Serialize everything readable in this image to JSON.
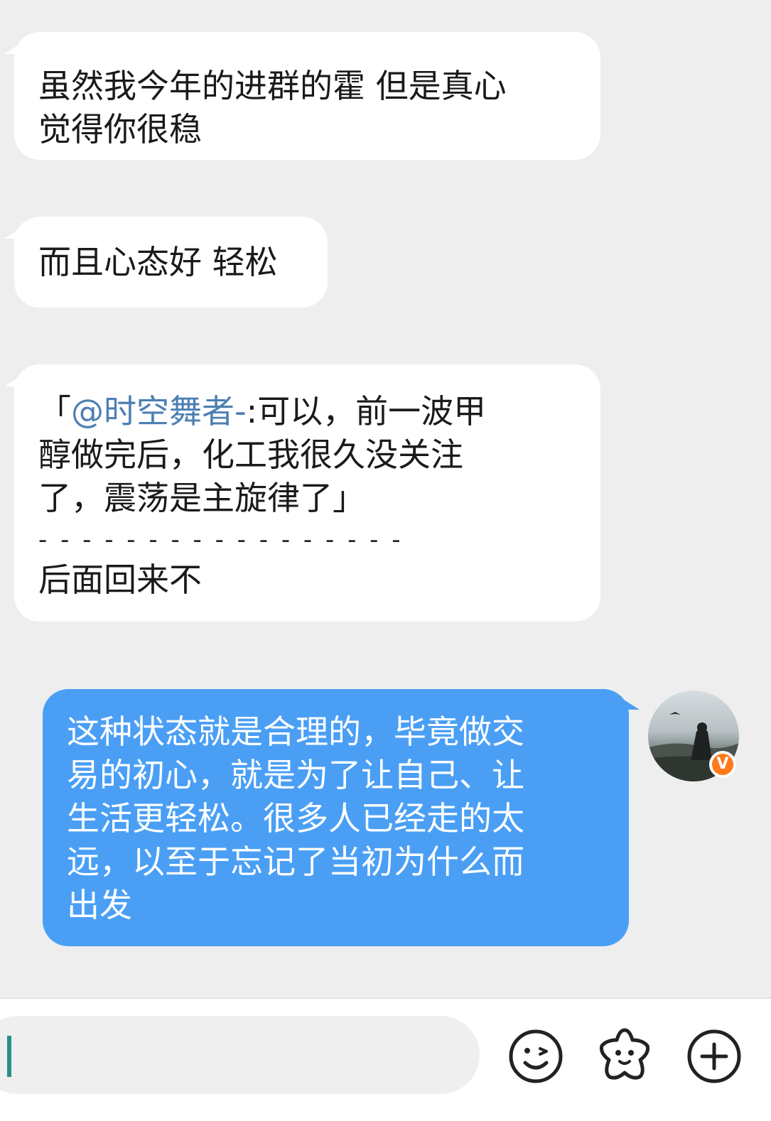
{
  "messages": [
    {
      "side": "incoming",
      "lines": [
        "虽然我今年的进群的霍 但是真心",
        "觉得你很稳"
      ]
    },
    {
      "side": "incoming",
      "text": "而且心态好 轻松"
    },
    {
      "side": "incoming",
      "quote": {
        "open": "「",
        "mention": "@时空舞者-",
        "rest_line1": ":可以，前一波甲",
        "line2": "醇做完后，化工我很久没关注",
        "line3": "了，震荡是主旋律了」"
      },
      "divider": "- - - - - - - - - - - - - - - - -",
      "reply": "后面回来不"
    },
    {
      "side": "outgoing",
      "lines": [
        "这种状态就是合理的，毕竟做交",
        "易的初心，就是为了让自己、让",
        "生活更轻松。很多人已经走的太",
        "远，以至于忘记了当初为什么而",
        "出发"
      ]
    }
  ],
  "avatar": {
    "badge": "V"
  },
  "composer": {
    "placeholder": ""
  },
  "toolbar": {
    "icons": [
      "emoji-icon",
      "sticker-icon",
      "plus-icon"
    ]
  }
}
